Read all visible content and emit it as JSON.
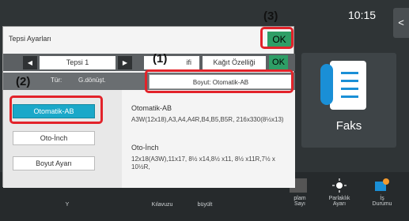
{
  "status": {
    "clock": "10:15",
    "side_arrow": "<"
  },
  "home": {
    "fax_label": "Faks",
    "bottom_bar": [
      {
        "label": "Y",
        "icon": "partial-icon"
      },
      {
        "label": "Kılavuzu",
        "icon": "guide-icon"
      },
      {
        "label": "büyült",
        "icon": "zoom-icon"
      },
      {
        "label": "plam\nSayı",
        "icon": "counter-icon"
      },
      {
        "label": "Parlaklık\nAyarı",
        "icon": "brightness-icon"
      },
      {
        "label": "İş\nDurumu",
        "icon": "job-status-icon"
      }
    ]
  },
  "dialog": {
    "title": "Tepsi Ayarları",
    "ok_label": "OK",
    "tray_prev": "◀",
    "tray_label": "Tepsi 1",
    "tray_next": "▶",
    "paper_type_fragment": "ifi",
    "paper_property_label": "Kağıt Özelliği",
    "ok_small_label": "OK",
    "type_label": "Tür:",
    "type_value": "G.dönüşt.",
    "size_label": "Boyut: Otomatik-AB",
    "options": [
      "Otomatik-AB",
      "Oto-İnch",
      "Boyut Ayarı"
    ],
    "selected_option": "Otomatik-AB",
    "auto_ab_title": "Otomatik-AB",
    "auto_ab_sizes": "A3W(12x18),A3,A4,A4R,B4,B5,B5R, 216x330(8½x13)",
    "auto_inch_title": "Oto-İnch",
    "auto_inch_sizes": "12x18(A3W),11x17, 8½ x14,8½ x11, 8½ x11R,7½ x 10½R,"
  },
  "annotations": {
    "a1": "(1)",
    "a2": "(2)",
    "a3": "(3)"
  },
  "colors": {
    "accent": "#1ba8c9",
    "ok_green": "#2e9e66",
    "highlight_red": "#e2232a"
  }
}
